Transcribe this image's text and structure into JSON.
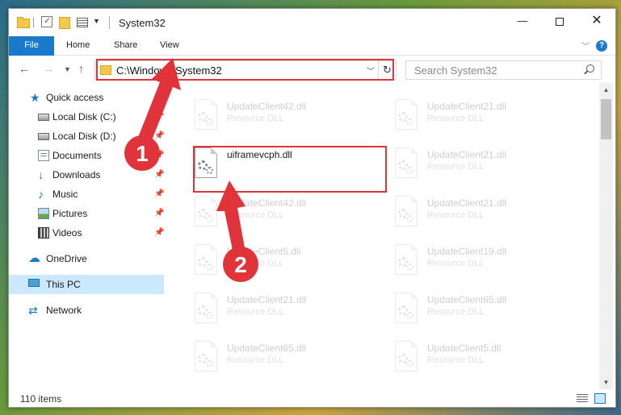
{
  "window": {
    "title": "System32"
  },
  "ribbon": {
    "tabs": [
      "File",
      "Home",
      "Share",
      "View"
    ]
  },
  "navbar": {
    "address": "C:\\Windows\\System32",
    "search_placeholder": "Search System32"
  },
  "sidebar": {
    "items": [
      {
        "label": "Quick access",
        "icon": "star-icon",
        "pinned": false
      },
      {
        "label": "Local Disk (C:)",
        "icon": "drive-icon",
        "pinned": true
      },
      {
        "label": "Local Disk (D:)",
        "icon": "drive-icon",
        "pinned": true
      },
      {
        "label": "Documents",
        "icon": "documents-icon",
        "pinned": true
      },
      {
        "label": "Downloads",
        "icon": "download-icon",
        "pinned": true
      },
      {
        "label": "Music",
        "icon": "music-icon",
        "pinned": true
      },
      {
        "label": "Pictures",
        "icon": "pictures-icon",
        "pinned": true
      },
      {
        "label": "Videos",
        "icon": "videos-icon",
        "pinned": true
      },
      {
        "label": "OneDrive",
        "icon": "onedrive-icon",
        "pinned": false
      },
      {
        "label": "This PC",
        "icon": "pc-icon",
        "pinned": false,
        "selected": true
      },
      {
        "label": "Network",
        "icon": "network-icon",
        "pinned": false
      }
    ]
  },
  "files": {
    "left": [
      {
        "name": "UpdateClient42.dll",
        "type": "Resource DLL",
        "faded": true
      },
      {
        "name": "uiframevcph.dll",
        "type": "",
        "faded": false
      },
      {
        "name": "UpdateClient42.dll",
        "type": "Resource DLL",
        "faded": true
      },
      {
        "name": "UpdateClient5.dll",
        "type": "Resource DLL",
        "faded": true
      },
      {
        "name": "UpdateClient21.dll",
        "type": "Resource DLL",
        "faded": true
      },
      {
        "name": "UpdateClient65.dll",
        "type": "Resource DLL",
        "faded": true
      }
    ],
    "right": [
      {
        "name": "UpdateClient21.dll",
        "type": "Resource DLL",
        "faded": true
      },
      {
        "name": "UpdateClient21.dll",
        "type": "Resource DLL",
        "faded": true
      },
      {
        "name": "UpdateClient21.dll",
        "type": "Resource DLL",
        "faded": true
      },
      {
        "name": "UpdateClient19.dll",
        "type": "Resource DLL",
        "faded": true
      },
      {
        "name": "UpdateClient65.dll",
        "type": "Resource DLL",
        "faded": true
      },
      {
        "name": "UpdateClient5.dll",
        "type": "Resource DLL",
        "faded": true
      }
    ]
  },
  "status": {
    "item_count": "110 items"
  },
  "annotations": {
    "step1": "1",
    "step2": "2",
    "color": "#e0343a"
  },
  "colors": {
    "accent": "#1979ca",
    "highlight": "#e0343a",
    "selection": "#cce8ff"
  }
}
